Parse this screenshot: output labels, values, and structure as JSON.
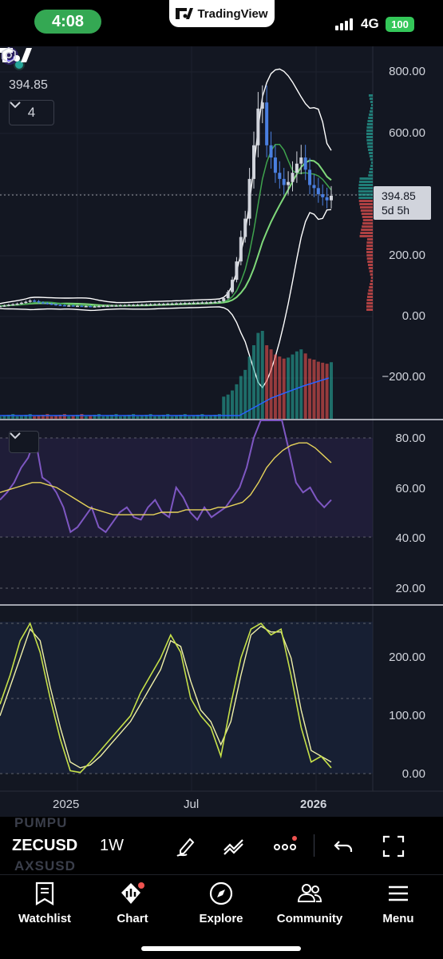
{
  "status_bar": {
    "time": "4:08",
    "brand": "TradingView",
    "network": "4G",
    "battery": "100"
  },
  "chart": {
    "symbol": "ZECUSD",
    "interval": "1W",
    "current_price": "394.85",
    "countdown": "5d 5h",
    "indicator_count": "4",
    "ghost_symbols": [
      "PUMPU",
      "AXSUSD"
    ],
    "price_axis": [
      "800.00",
      "600.00",
      "400.00",
      "200.00",
      "0.00",
      "−200.00"
    ],
    "rsi_axis": [
      "80.00",
      "60.00",
      "40.00",
      "20.00"
    ],
    "osc_axis": [
      "200.00",
      "100.00",
      "0.00"
    ],
    "time_axis": [
      "2025",
      "Jul",
      "2026"
    ],
    "colors": {
      "bg": "#131722",
      "up": "#26a69a",
      "down": "#ef5350",
      "rsi": "#7e57c2",
      "rsi_ma": "#e6d35a",
      "osc_fast": "#c6e048",
      "osc_slow": "#f0f0a8"
    }
  },
  "chart_data": [
    {
      "type": "line",
      "name_context": "price",
      "x": [
        0,
        1,
        2,
        3,
        4,
        5,
        6,
        7,
        8,
        9,
        10,
        11,
        12,
        13,
        14,
        15,
        16,
        17,
        18,
        19,
        20,
        21,
        22,
        23,
        24,
        25,
        26,
        27,
        28,
        29,
        30,
        31,
        32,
        33,
        34,
        35,
        36,
        37,
        38,
        39,
        40,
        41,
        42,
        43,
        44,
        45,
        46,
        47,
        48,
        49,
        50,
        51,
        52,
        53,
        54,
        55,
        56,
        57,
        58,
        59,
        60,
        61,
        62,
        63,
        64,
        65,
        66,
        67,
        68,
        69,
        70,
        71,
        72,
        73,
        74,
        75,
        76,
        77
      ],
      "close": [
        34,
        36,
        38,
        40,
        42,
        45,
        48,
        52,
        50,
        46,
        44,
        42,
        40,
        38,
        37,
        36,
        36,
        35,
        35,
        34,
        34,
        33,
        33,
        34,
        35,
        35,
        36,
        36,
        37,
        37,
        38,
        38,
        38,
        39,
        39,
        40,
        40,
        41,
        41,
        42,
        42,
        43,
        43,
        44,
        44,
        45,
        45,
        46,
        46,
        47,
        48,
        50,
        60,
        80,
        120,
        180,
        260,
        320,
        450,
        560,
        680,
        700,
        560,
        520,
        470,
        450,
        430,
        440,
        470,
        500,
        520,
        480,
        430,
        420,
        400,
        390,
        380,
        394.85
      ],
      "ylim": [
        -300,
        850
      ]
    },
    {
      "type": "line",
      "name_context": "RSI",
      "values": [
        55,
        58,
        62,
        68,
        72,
        80,
        64,
        62,
        58,
        52,
        42,
        44,
        48,
        52,
        44,
        42,
        46,
        50,
        52,
        48,
        47,
        52,
        55,
        50,
        48,
        60,
        56,
        50,
        47,
        52,
        48,
        50,
        52,
        56,
        60,
        68,
        80,
        95,
        99,
        98,
        90,
        75,
        62,
        58,
        60,
        55,
        52,
        55
      ],
      "ma": [
        58,
        59,
        60,
        61,
        62,
        62,
        61,
        60,
        58,
        56,
        54,
        52,
        51,
        50,
        49,
        49,
        49,
        49,
        49,
        49,
        50,
        50,
        50,
        51,
        51,
        51,
        51,
        52,
        52,
        53,
        54,
        57,
        62,
        68,
        72,
        75,
        77,
        78,
        78,
        76,
        73,
        70
      ],
      "ylim": [
        10,
        90
      ]
    },
    {
      "type": "line",
      "name_context": "oscillator",
      "fast": [
        120,
        170,
        230,
        260,
        210,
        130,
        60,
        5,
        2,
        20,
        40,
        60,
        80,
        100,
        140,
        170,
        200,
        240,
        210,
        130,
        100,
        80,
        30,
        120,
        200,
        250,
        260,
        240,
        250,
        170,
        80,
        20,
        30,
        10
      ],
      "slow": [
        100,
        150,
        200,
        250,
        230,
        150,
        80,
        20,
        10,
        15,
        30,
        50,
        70,
        90,
        120,
        150,
        180,
        230,
        220,
        160,
        110,
        90,
        50,
        90,
        170,
        240,
        255,
        245,
        245,
        200,
        110,
        40,
        30,
        20
      ],
      "ylim": [
        -10,
        270
      ]
    }
  ],
  "toolbar": {
    "icons": [
      "pen-icon",
      "indicators-icon",
      "more-icon",
      "undo-icon",
      "fullscreen-icon"
    ]
  },
  "tabs": [
    {
      "label": "Watchlist",
      "icon": "watchlist-icon"
    },
    {
      "label": "Chart",
      "icon": "chart-icon"
    },
    {
      "label": "Explore",
      "icon": "compass-icon"
    },
    {
      "label": "Community",
      "icon": "people-icon"
    },
    {
      "label": "Menu",
      "icon": "menu-icon"
    }
  ]
}
